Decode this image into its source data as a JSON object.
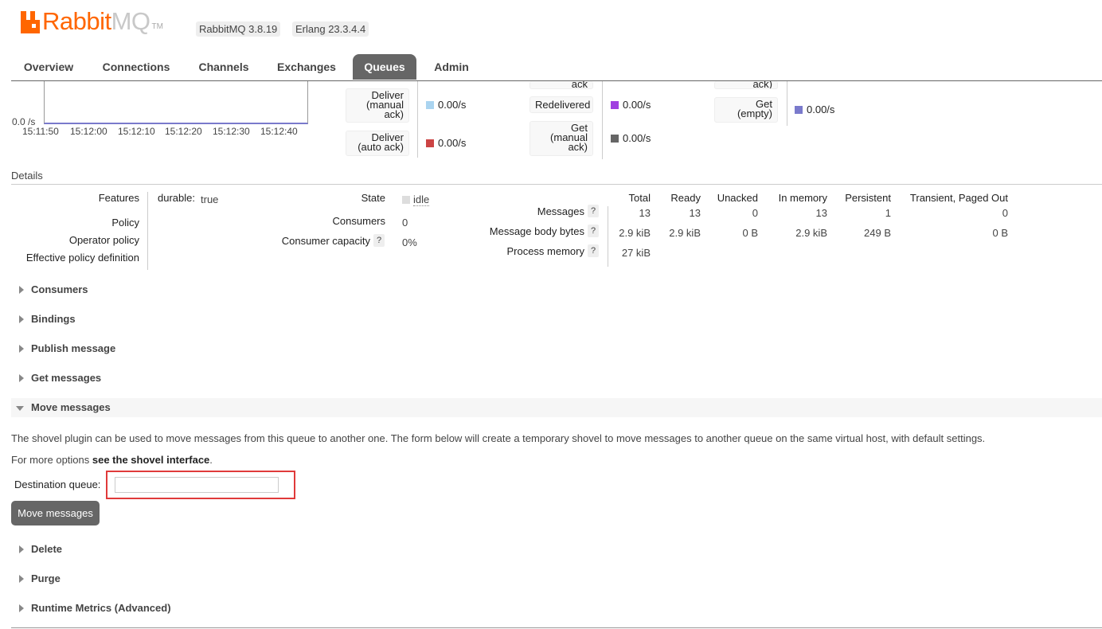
{
  "header": {
    "logo_rabbit": "Rabbit",
    "logo_mq": "MQ",
    "logo_tm": "TM",
    "rabbitmq_version": "RabbitMQ 3.8.19",
    "erlang_version": "Erlang 23.3.4.4"
  },
  "tabs": [
    {
      "label": "Overview",
      "active": false
    },
    {
      "label": "Connections",
      "active": false
    },
    {
      "label": "Channels",
      "active": false
    },
    {
      "label": "Exchanges",
      "active": false
    },
    {
      "label": "Queues",
      "active": true
    },
    {
      "label": "Admin",
      "active": false
    }
  ],
  "chart": {
    "y_label": "0.0 /s",
    "x_ticks": [
      "15:11:50",
      "15:12:00",
      "15:12:10",
      "15:12:20",
      "15:12:30",
      "15:12:40"
    ]
  },
  "rates": {
    "col1": [
      {
        "label_lines": [
          "Deliver",
          "(manual",
          "ack)"
        ],
        "value": "0.00/s",
        "color": "#aad4f0"
      },
      {
        "label_lines": [
          "Deliver",
          "(auto ack)"
        ],
        "value": "0.00/s",
        "color": "#cc4444"
      }
    ],
    "col2_cut": "ack",
    "col2": [
      {
        "label_lines": [
          "Redelivered"
        ],
        "value": "0.00/s",
        "color": "#a040e0"
      },
      {
        "label_lines": [
          "Get",
          "(manual",
          "ack)"
        ],
        "value": "0.00/s",
        "color": "#666666"
      }
    ],
    "col3_cut": "ack)",
    "col3": [
      {
        "label_lines": [
          "Get",
          "(empty)"
        ],
        "value": "0.00/s",
        "color": "#7a7acc"
      }
    ]
  },
  "details": {
    "title": "Details",
    "features_label": "Features",
    "features_key": "durable:",
    "features_value": "true",
    "policy_label": "Policy",
    "operator_policy_label": "Operator policy",
    "effective_policy_label": "Effective policy definition",
    "state_label": "State",
    "state_value": "idle",
    "consumers_label": "Consumers",
    "consumers_value": "0",
    "consumer_capacity_label": "Consumer capacity",
    "consumer_capacity_value": "0%",
    "help": "?",
    "stats_headers": [
      "Total",
      "Ready",
      "Unacked",
      "In memory",
      "Persistent",
      "Transient, Paged Out"
    ],
    "stats_rows": [
      {
        "label": "Messages",
        "values": [
          "13",
          "13",
          "0",
          "13",
          "1",
          "0"
        ]
      },
      {
        "label": "Message body bytes",
        "values": [
          "2.9 kiB",
          "2.9 kiB",
          "0 B",
          "2.9 kiB",
          "249 B",
          "0 B"
        ]
      },
      {
        "label": "Process memory",
        "values": [
          "27 kiB"
        ]
      }
    ]
  },
  "sections": {
    "consumers": "Consumers",
    "bindings": "Bindings",
    "publish": "Publish message",
    "get": "Get messages",
    "move": "Move messages",
    "delete": "Delete",
    "purge": "Purge",
    "runtime": "Runtime Metrics (Advanced)"
  },
  "move": {
    "description": "The shovel plugin can be used to move messages from this queue to another one. The form below will create a temporary shovel to move messages to another queue on the same virtual host, with default settings.",
    "more_prefix": "For more options ",
    "more_link": "see the shovel interface",
    "more_suffix": ".",
    "dest_label": "Destination queue:",
    "dest_value": "",
    "button": "Move messages"
  }
}
